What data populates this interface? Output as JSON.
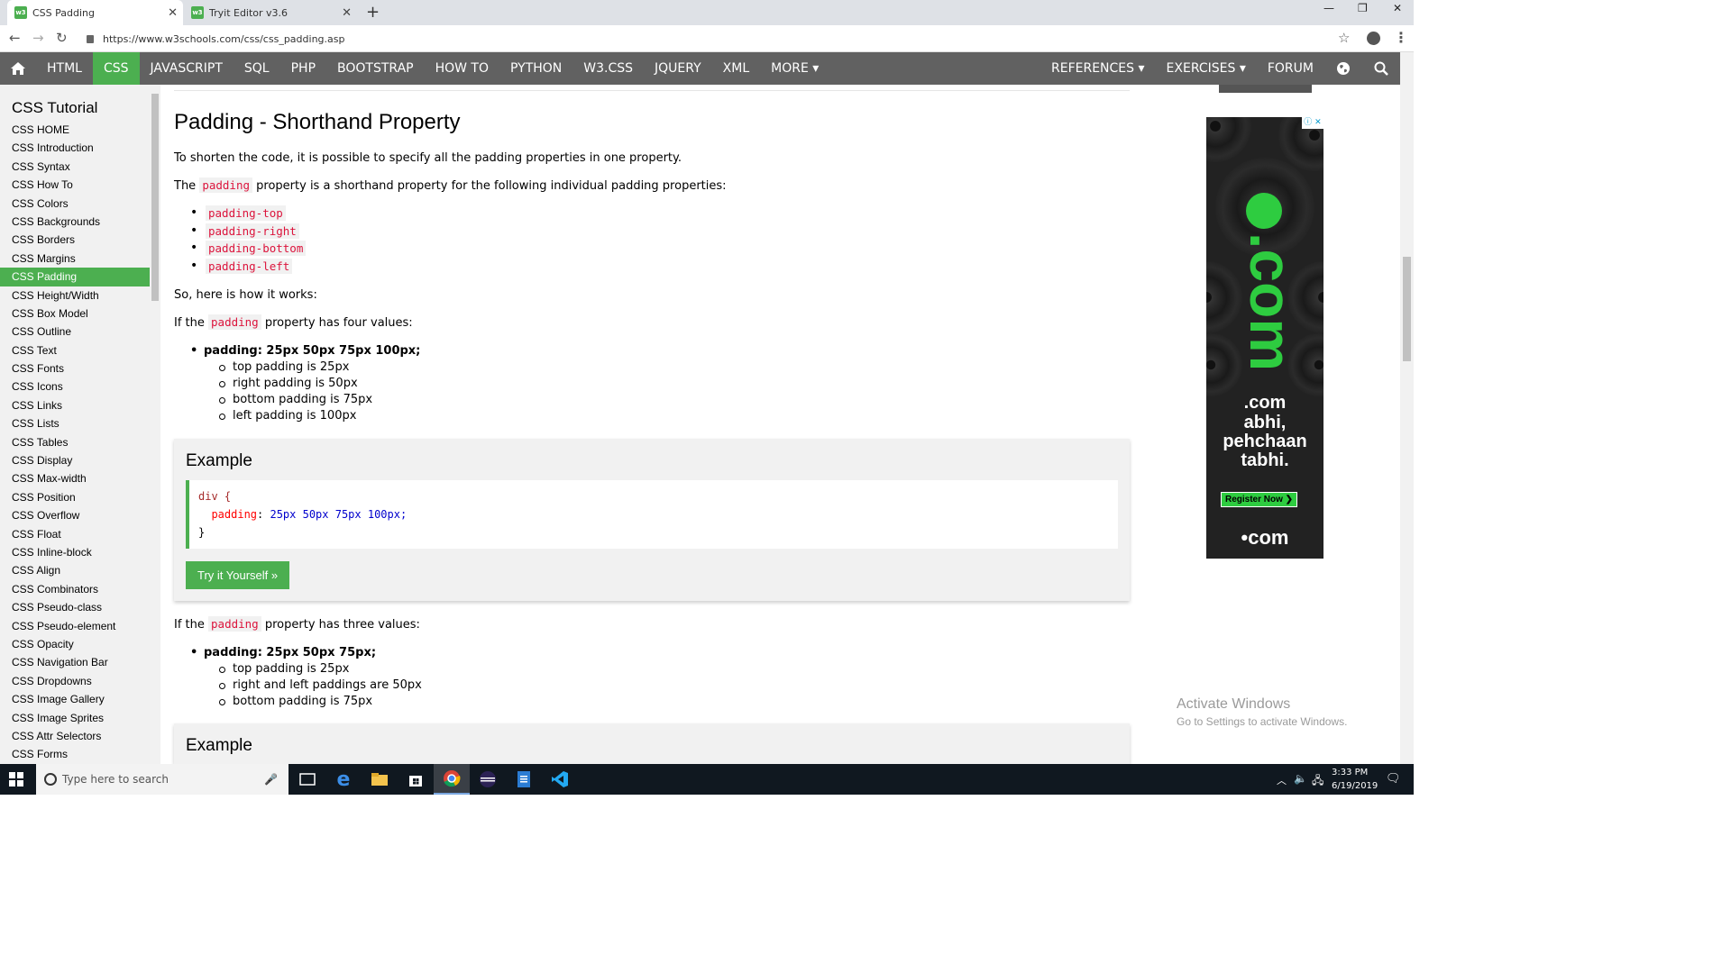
{
  "browser": {
    "tabs": [
      {
        "favicon": "w3",
        "title": "CSS Padding",
        "active": true
      },
      {
        "favicon": "w3",
        "title": "Tryit Editor v3.6",
        "active": false
      }
    ],
    "url": "https://www.w3schools.com/css/css_padding.asp"
  },
  "topnav": {
    "items": [
      "HTML",
      "CSS",
      "JAVASCRIPT",
      "SQL",
      "PHP",
      "BOOTSTRAP",
      "HOW TO",
      "PYTHON",
      "W3.CSS",
      "JQUERY",
      "XML",
      "MORE ▾"
    ],
    "active": "CSS",
    "right": [
      "REFERENCES ▾",
      "EXERCISES ▾",
      "FORUM"
    ]
  },
  "sidebar": {
    "title": "CSS Tutorial",
    "items": [
      "CSS HOME",
      "CSS Introduction",
      "CSS Syntax",
      "CSS How To",
      "CSS Colors",
      "CSS Backgrounds",
      "CSS Borders",
      "CSS Margins",
      "CSS Padding",
      "CSS Height/Width",
      "CSS Box Model",
      "CSS Outline",
      "CSS Text",
      "CSS Fonts",
      "CSS Icons",
      "CSS Links",
      "CSS Lists",
      "CSS Tables",
      "CSS Display",
      "CSS Max-width",
      "CSS Position",
      "CSS Overflow",
      "CSS Float",
      "CSS Inline-block",
      "CSS Align",
      "CSS Combinators",
      "CSS Pseudo-class",
      "CSS Pseudo-element",
      "CSS Opacity",
      "CSS Navigation Bar",
      "CSS Dropdowns",
      "CSS Image Gallery",
      "CSS Image Sprites",
      "CSS Attr Selectors",
      "CSS Forms"
    ],
    "active": "CSS Padding"
  },
  "content": {
    "heading": "Padding - Shorthand Property",
    "intro": "To shorten the code, it is possible to specify all the padding properties in one property.",
    "shorthand_pre": "The",
    "shorthand_code": "padding",
    "shorthand_post": "property is a shorthand property for the following individual padding properties:",
    "properties": [
      "padding-top",
      "padding-right",
      "padding-bottom",
      "padding-left"
    ],
    "how": "So, here is how it works:",
    "four_pre": "If the",
    "four_code": "padding",
    "four_post": "property has four values:",
    "four_value": "padding: 25px 50px 75px 100px;",
    "four_items": [
      "top padding is 25px",
      "right padding is 50px",
      "bottom padding is 75px",
      "left padding is 100px"
    ],
    "example_title": "Example",
    "code_selector": "div {",
    "code_prop": "padding",
    "code_value": "25px 50px 75px 100px;",
    "code_close": "}",
    "try_button": "Try it Yourself »",
    "three_pre": "If the",
    "three_code": "padding",
    "three_post": "property has three values:",
    "three_value": "padding: 25px 50px 75px;",
    "three_items": [
      "top padding is 25px",
      "right and left paddings are 50px",
      "bottom padding is 75px"
    ],
    "example2_title": "Example"
  },
  "ad": {
    "brand": ".com",
    "line1": ".com",
    "line2": "abhi,",
    "line3": "pehchaan",
    "line4": "tabhi.",
    "cta": "Register Now",
    "footer": "•com"
  },
  "watermark": {
    "title": "Activate Windows",
    "subtitle": "Go to Settings to activate Windows."
  },
  "taskbar": {
    "search_placeholder": "Type here to search",
    "time": "3:33 PM",
    "date": "6/19/2019"
  }
}
